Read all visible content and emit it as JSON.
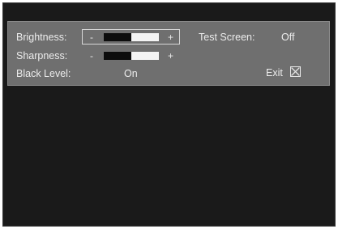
{
  "osd": {
    "brightness": {
      "label": "Brightness:",
      "minus": "-",
      "plus": "+",
      "level": 0.5
    },
    "sharpness": {
      "label": "Sharpness:",
      "minus": "-",
      "plus": "+",
      "level": 0.5
    },
    "black_level": {
      "label": "Black Level:",
      "value": "On"
    },
    "test_screen": {
      "label": "Test Screen:",
      "value": "Off"
    },
    "exit": {
      "label": "Exit",
      "icon": "close-box-icon"
    }
  },
  "colors": {
    "screen_background": "#1a1a1a",
    "panel_background": "#6f6f6f",
    "text": "#ececec"
  }
}
